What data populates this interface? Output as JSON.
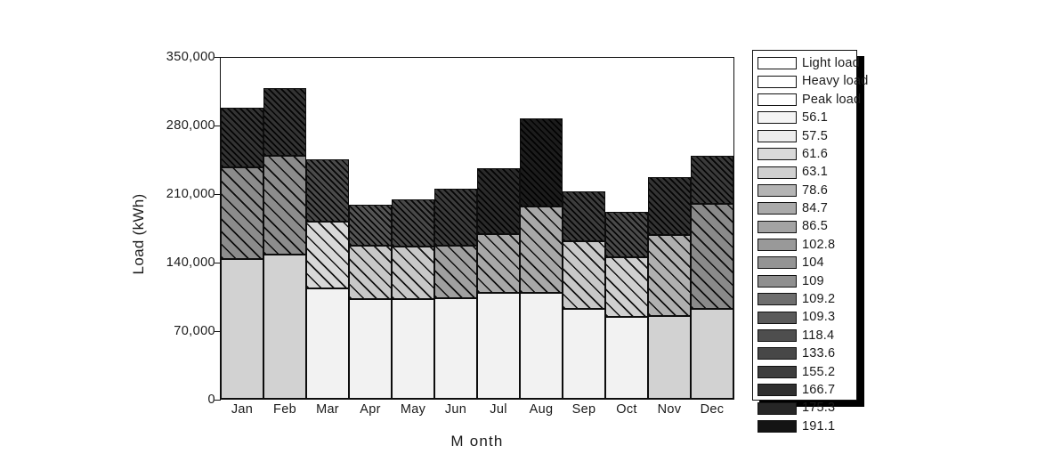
{
  "chart_data": {
    "type": "bar",
    "title": "",
    "xlabel": "M onth",
    "ylabel": "Load (kWh)",
    "stacked": true,
    "grid": false,
    "legend_position": "right",
    "ylim": [
      0,
      350000
    ],
    "yticks": [
      0,
      70000,
      140000,
      210000,
      280000,
      350000
    ],
    "ytick_labels": [
      "0",
      "70,000",
      "140,000",
      "210,000",
      "280,000",
      "350,000"
    ],
    "categories": [
      "Jan",
      "Feb",
      "Mar",
      "Apr",
      "May",
      "Jun",
      "Jul",
      "Aug",
      "Sep",
      "Oct",
      "Nov",
      "Dec"
    ],
    "series": [
      {
        "name": "Light load",
        "values": [
          142700,
          147200,
          112700,
          101800,
          101800,
          102700,
          108200,
          108200,
          91800,
          83600,
          84500,
          91800
        ]
      },
      {
        "name": "Heavy load",
        "values": [
          93600,
          100900,
          68200,
          54500,
          53600,
          53600,
          60000,
          88200,
          69100,
          60900,
          82700,
          107300
        ]
      },
      {
        "name": "Peak load",
        "values": [
          60900,
          69100,
          63600,
          41800,
          48200,
          58200,
          67300,
          90000,
          50900,
          46400,
          59100,
          49100
        ]
      }
    ],
    "totals": [
      297200,
      317200,
      244500,
      198100,
      203600,
      214500,
      235500,
      286400,
      211800,
      190900,
      226300,
      248200
    ]
  },
  "legend": {
    "pattern_entries": [
      {
        "label": "Light load",
        "pattern": "solid",
        "fill": "#ffffff"
      },
      {
        "label": "Heavy load",
        "pattern": "wide-diagonal-hatch",
        "fill": "#ffffff"
      },
      {
        "label": "Peak load",
        "pattern": "dense-diagonal-hatch",
        "fill": "#ffffff"
      }
    ],
    "scale_entries": [
      {
        "label": "56.1",
        "fill": "#f4f4f4"
      },
      {
        "label": "57.5",
        "fill": "#ededed"
      },
      {
        "label": "61.6",
        "fill": "#d9d9d9"
      },
      {
        "label": "63.1",
        "fill": "#d0d0d0"
      },
      {
        "label": "78.6",
        "fill": "#b4b4b4"
      },
      {
        "label": "84.7",
        "fill": "#aaaaaa"
      },
      {
        "label": "86.5",
        "fill": "#a3a3a3"
      },
      {
        "label": "102.8",
        "fill": "#999999"
      },
      {
        "label": "104",
        "fill": "#949494"
      },
      {
        "label": "109",
        "fill": "#8f8f8f"
      },
      {
        "label": "109.2",
        "fill": "#6e6e6e"
      },
      {
        "label": "109.3",
        "fill": "#5a5a5a"
      },
      {
        "label": "118.4",
        "fill": "#4e4e4e"
      },
      {
        "label": "133.6",
        "fill": "#474747"
      },
      {
        "label": "155.2",
        "fill": "#3d3d3d"
      },
      {
        "label": "166.7",
        "fill": "#2f2f2f"
      },
      {
        "label": "175.3",
        "fill": "#262626"
      },
      {
        "label": "191.1",
        "fill": "#141414"
      }
    ]
  },
  "bar_styles": {
    "light_fill": [
      "#d2d2d2",
      "#d2d2d2",
      "#f2f2f2",
      "#f2f2f2",
      "#f2f2f2",
      "#f2f2f2",
      "#f2f2f2",
      "#f2f2f2",
      "#f2f2f2",
      "#f2f2f2",
      "#d2d2d2",
      "#d2d2d2"
    ],
    "heavy_fill": [
      "#8c8c8c",
      "#8c8c8c",
      "#d8d8d8",
      "#c8c8c8",
      "#c8c8c8",
      "#a0a0a0",
      "#a8a8a8",
      "#a8a8a8",
      "#c8c8c8",
      "#d0d0d0",
      "#b0b0b0",
      "#8a8a8a"
    ],
    "peak_fill": [
      "#333333",
      "#333333",
      "#4a4a4a",
      "#555555",
      "#484848",
      "#3a3a3a",
      "#2a2a2a",
      "#1c1c1c",
      "#3c3c3c",
      "#4a4a4a",
      "#333333",
      "#3a3a3a"
    ],
    "stroke": "#0d0d0d"
  }
}
